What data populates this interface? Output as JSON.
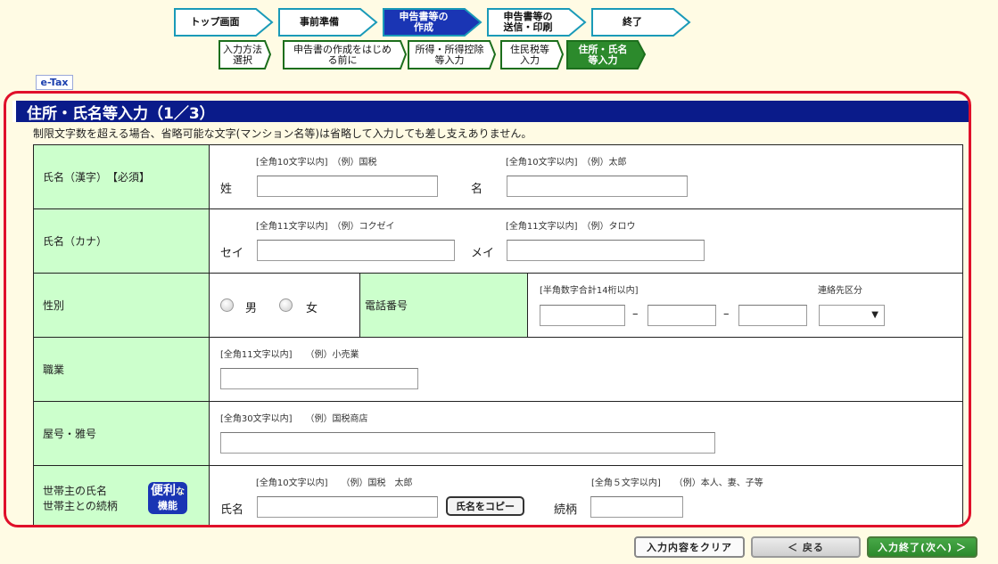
{
  "steps": [
    {
      "label": "トップ画面",
      "active": false
    },
    {
      "label": "事前準備",
      "active": false
    },
    {
      "label": "申告書等の\n作成",
      "active": true
    },
    {
      "label": "申告書等の\n送信・印刷",
      "active": false
    },
    {
      "label": "終了",
      "active": false
    }
  ],
  "substeps": [
    {
      "label": "入力方法\n選択",
      "active": false
    },
    {
      "label": "申告書の作成をはじめ\nる前に",
      "active": false
    },
    {
      "label": "所得・所得控除\n等入力",
      "active": false
    },
    {
      "label": "住民税等\n入力",
      "active": false
    },
    {
      "label": "住所・氏名\n等入力",
      "active": true
    }
  ],
  "etax_badge": "e-Tax",
  "title": "住所・氏名等入力（1／3）",
  "notice": "制限文字数を超える場合、省略可能な文字(マンション名等)は省略して入力しても差し支えありません。",
  "rows": {
    "name_kanji": {
      "label": "氏名（漢字）　【必須】",
      "sei_hint": "[全角10文字以内]　（例）国税",
      "mei_hint": "[全角10文字以内]　（例）太郎",
      "sei_label": "姓",
      "mei_label": "名",
      "sei_value": "",
      "mei_value": ""
    },
    "name_kana": {
      "label": "氏名（カナ）",
      "sei_hint": "[全角11文字以内]　（例）コクゼイ",
      "mei_hint": "[全角11文字以内]　（例）タロウ",
      "sei_label": "セイ",
      "mei_label": "メイ",
      "sei_value": "",
      "mei_value": ""
    },
    "gender": {
      "label": "性別",
      "male": "男",
      "female": "女",
      "tel_label": "電話番号",
      "tel_hint": "[半角数字合計14桁以内]",
      "contact_label": "連絡先区分",
      "dash": "–",
      "contact_value": ""
    },
    "job": {
      "label": "職業",
      "hint": "[全角11文字以内]　　（例）小売業",
      "value": ""
    },
    "yago": {
      "label": "屋号・雅号",
      "hint": "[全角30文字以内]　　（例）国税商店",
      "value": ""
    },
    "householder": {
      "label_1": "世帯主の氏名",
      "label_2": "世帯主との続柄",
      "benri_1": "便利",
      "benri_small": "な",
      "benri_2": "機能",
      "name_hint": "[全角10文字以内]　　（例）国税　太郎",
      "rel_hint": "[全角５文字以内]　　（例）本人、妻、子等",
      "name_label": "氏名",
      "rel_label": "続柄",
      "copy_button": "氏名をコピー",
      "name_value": "",
      "rel_value": ""
    }
  },
  "buttons": {
    "clear": "入力内容をクリア",
    "back": "＜ 戻る",
    "next": "入力終了(次へ)",
    "next_arrow": "＞"
  },
  "colors": {
    "title_bar": "#0a1b8a",
    "highlight_border": "#e0102a",
    "label_bg": "#ccffcc",
    "active_step": "#1a35b4",
    "active_substep": "#2c8a2c"
  }
}
